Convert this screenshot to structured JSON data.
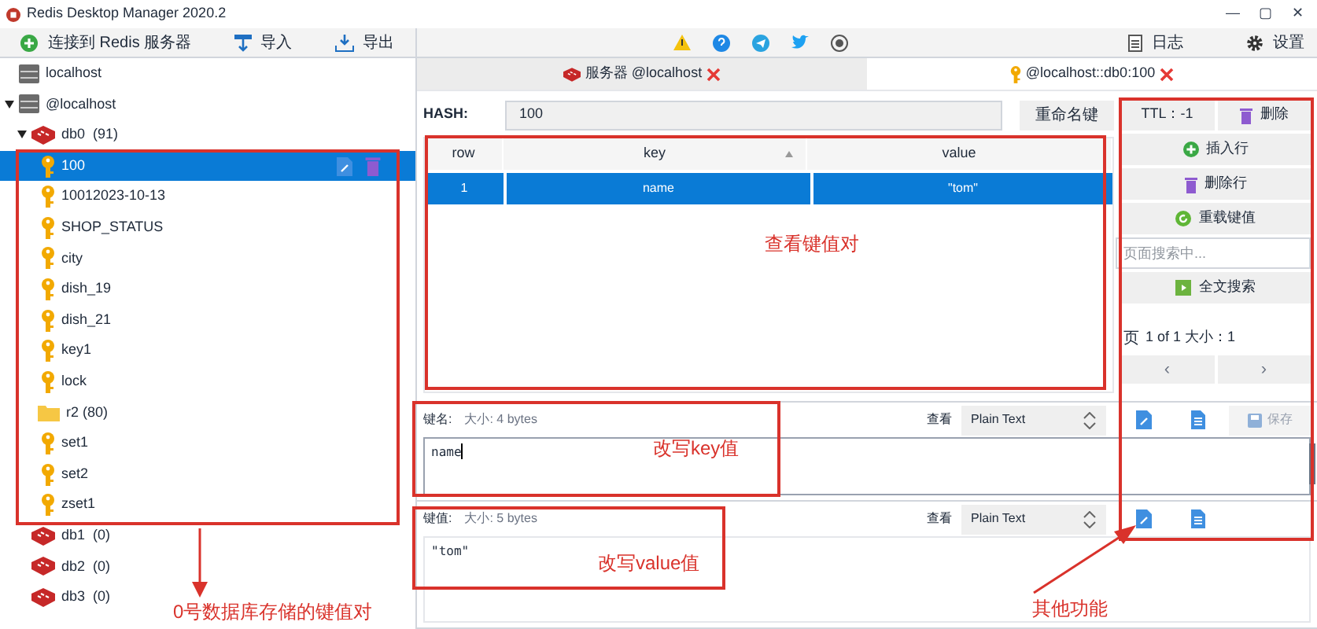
{
  "window": {
    "title": "Redis Desktop Manager 2020.2",
    "controls": [
      "—",
      "▢",
      "✕"
    ]
  },
  "toolbar": {
    "left": [
      {
        "kind": "connect",
        "label": "连接到 Redis 服务器"
      },
      {
        "kind": "import",
        "label": "导入"
      },
      {
        "kind": "export",
        "label": "导出"
      }
    ],
    "right": [
      {
        "kind": "log",
        "label": "日志"
      },
      {
        "kind": "settings",
        "label": "设置"
      }
    ]
  },
  "tree": [
    {
      "kind": "server",
      "label": "localhost",
      "expanded": false
    },
    {
      "kind": "server",
      "label": "@localhost",
      "expanded": true,
      "children": [
        {
          "kind": "db",
          "label": "db0",
          "count": "(91)",
          "expanded": true,
          "children": [
            {
              "kind": "key",
              "label": "100",
              "selected": true
            },
            {
              "kind": "key",
              "label": "10012023-10-13",
              "selected": false
            },
            {
              "kind": "key",
              "label": "SHOP_STATUS",
              "selected": false
            },
            {
              "kind": "key",
              "label": "city",
              "selected": false
            },
            {
              "kind": "key",
              "label": "dish_19",
              "selected": false
            },
            {
              "kind": "key",
              "label": "dish_21",
              "selected": false
            },
            {
              "kind": "key",
              "label": "key1",
              "selected": false
            },
            {
              "kind": "key",
              "label": "lock",
              "selected": false
            },
            {
              "kind": "folder",
              "label": "r2 (80)",
              "selected": false
            },
            {
              "kind": "key",
              "label": "set1",
              "selected": false
            },
            {
              "kind": "key",
              "label": "set2",
              "selected": false
            },
            {
              "kind": "key",
              "label": "zset1",
              "selected": false
            }
          ]
        },
        {
          "kind": "db",
          "label": "db1",
          "count": "(0)",
          "expanded": false
        },
        {
          "kind": "db",
          "label": "db2",
          "count": "(0)",
          "expanded": false
        },
        {
          "kind": "db",
          "label": "db3",
          "count": "(0)",
          "expanded": false
        }
      ]
    }
  ],
  "tabs": [
    {
      "kind": "server",
      "label": "服务器 @localhost",
      "selected": false
    },
    {
      "kind": "key",
      "label": "@localhost::db0:100",
      "selected": true
    }
  ],
  "key_header": {
    "type_label": "HASH:",
    "name": "100",
    "rename_button": "重命名键"
  },
  "table": {
    "columns": [
      {
        "label": "row",
        "sorted": false
      },
      {
        "label": "key",
        "sorted": true
      },
      {
        "label": "value",
        "sorted": false
      }
    ],
    "rows": [
      {
        "cells": [
          "1",
          "name",
          "\"tom\""
        ],
        "selected": true
      }
    ]
  },
  "side_panel": {
    "ttl": "TTL：-1",
    "delete_button": "删除",
    "buttons": [
      {
        "kind": "add",
        "label": "插入行"
      },
      {
        "kind": "delete",
        "label": "删除行"
      },
      {
        "kind": "reload",
        "label": "重载键值"
      }
    ],
    "search_placeholder": "页面搜索中...",
    "search_button": "全文搜索",
    "page_label": "页",
    "page_info": "1 of 1 大小：1",
    "prev": "‹",
    "next": "›"
  },
  "editors": [
    {
      "label": "键名:",
      "size": "大小: 4 bytes",
      "view_label": "查看",
      "format": "Plain Text",
      "value": "name",
      "focused": true,
      "save_button": {
        "label": "保存",
        "disabled": true
      }
    },
    {
      "label": "键值:",
      "size": "大小: 5 bytes",
      "view_label": "查看",
      "format": "Plain Text",
      "value": "\"tom\"",
      "focused": false
    }
  ],
  "annotations": [
    {
      "text": "查看键值对"
    },
    {
      "text": "改写key值"
    },
    {
      "text": "改写value值"
    },
    {
      "text": "0号数据库存储的键值对"
    },
    {
      "text": "其他功能"
    }
  ]
}
